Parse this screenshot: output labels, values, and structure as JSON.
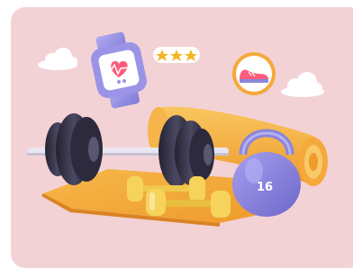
{
  "illustration": {
    "kettlebell_label": "16",
    "rating_stars": 3,
    "colors": {
      "card_bg": "#f3d2d6",
      "mat": "#f4a93a",
      "dumbbell_yellow": "#f6d45c",
      "barbell_dark": "#2f2d3f",
      "kettlebell": "#8c86d9",
      "watch_band": "#9b94e6",
      "heart": "#ff5a7d",
      "shoe_badge": "#ffffff",
      "cloud": "#ffffff",
      "star": "#f4b526"
    }
  }
}
